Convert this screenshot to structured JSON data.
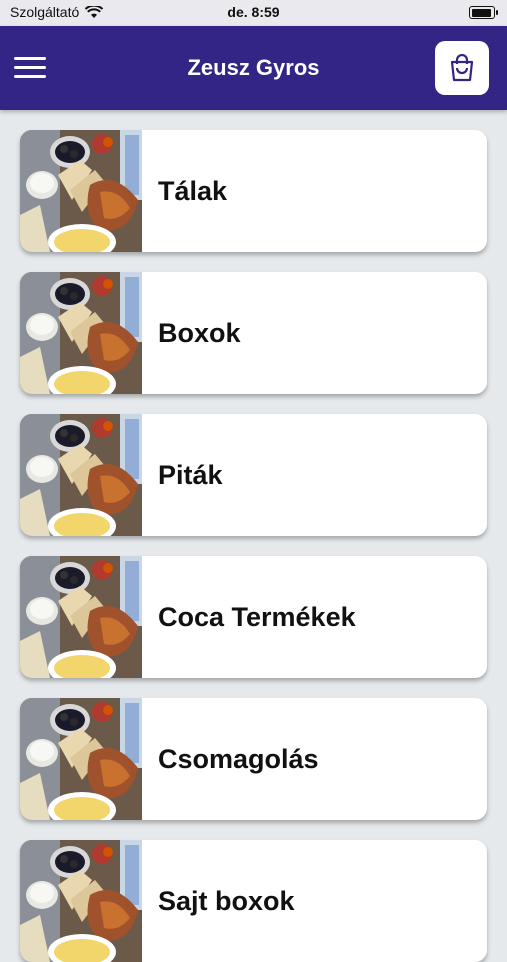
{
  "status_bar": {
    "carrier": "Szolgáltató",
    "time": "de. 8:59",
    "wifi_icon": "wifi-icon",
    "battery_icon": "battery-icon"
  },
  "header": {
    "title": "Zeusz Gyros",
    "menu_icon": "hamburger-menu-icon",
    "cart_icon": "shopping-bag-icon"
  },
  "categories": [
    {
      "label": "Tálak",
      "image": "food-platter-image"
    },
    {
      "label": "Boxok",
      "image": "food-platter-image"
    },
    {
      "label": "Piták",
      "image": "food-platter-image"
    },
    {
      "label": "Coca Termékek",
      "image": "food-platter-image"
    },
    {
      "label": "Csomagolás",
      "image": "food-platter-image"
    },
    {
      "label": "Sajt boxok",
      "image": "food-platter-image"
    }
  ],
  "colors": {
    "header_bg": "#322585",
    "page_bg": "#e5e9ec",
    "card_bg": "#ffffff"
  }
}
